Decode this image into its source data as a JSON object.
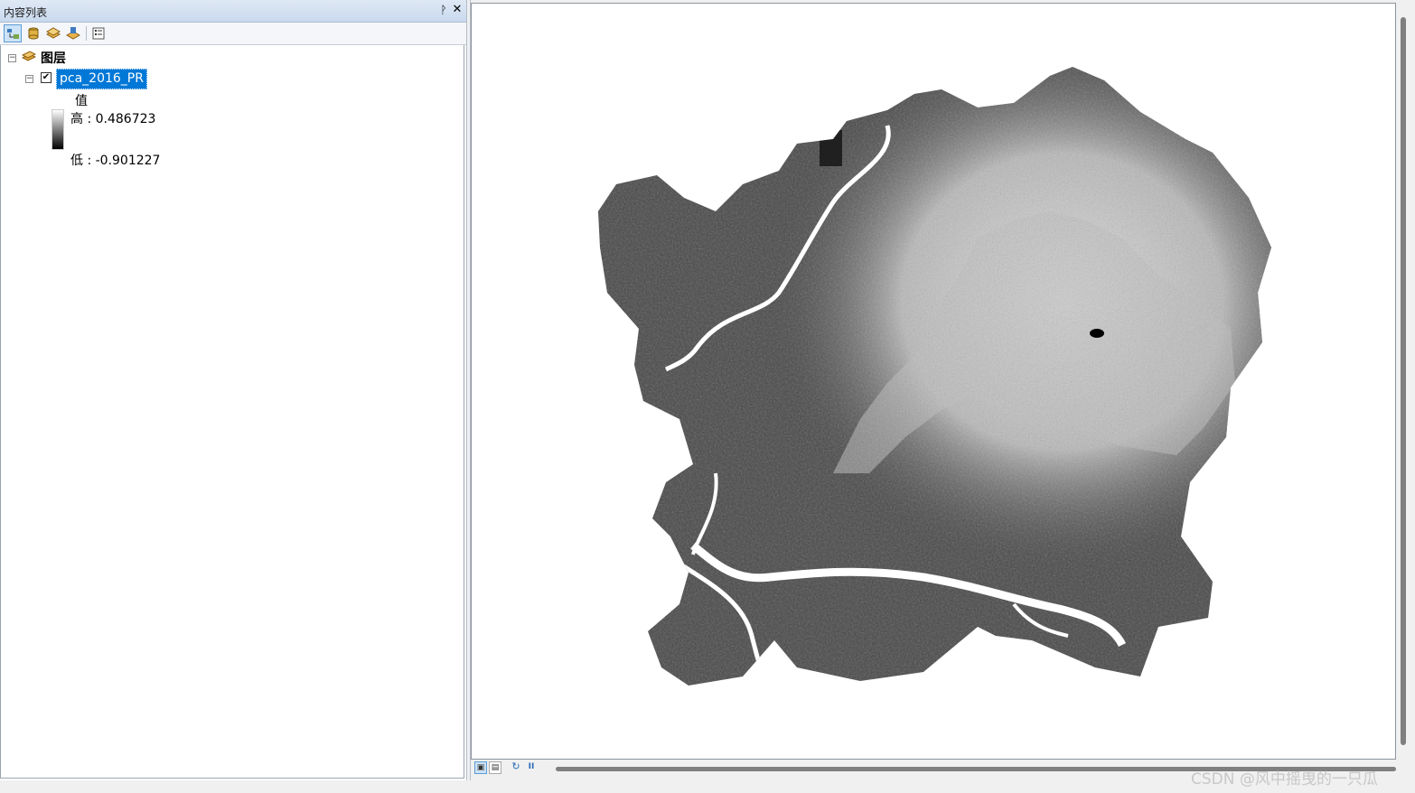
{
  "toc": {
    "title": "内容列表",
    "toolbar": [
      {
        "name": "list-by-drawing-order-icon",
        "active": true
      },
      {
        "name": "list-by-source-icon",
        "active": false
      },
      {
        "name": "list-by-visibility-icon",
        "active": false
      },
      {
        "name": "list-by-selection-icon",
        "active": false
      },
      {
        "name": "options-icon",
        "active": false
      }
    ],
    "tree": {
      "root_label": "图层",
      "layer": {
        "name": "pca_2016_PR",
        "checked": true,
        "legend": {
          "heading": "值",
          "high": "高 : 0.486723",
          "low": "低 : -0.901227"
        }
      }
    }
  },
  "watermark": "CSDN @风中摇曳的一只瓜",
  "colors": {
    "selection": "#0078d7",
    "titlebar": "#c9d9ee",
    "map_background": "#ffffff"
  }
}
